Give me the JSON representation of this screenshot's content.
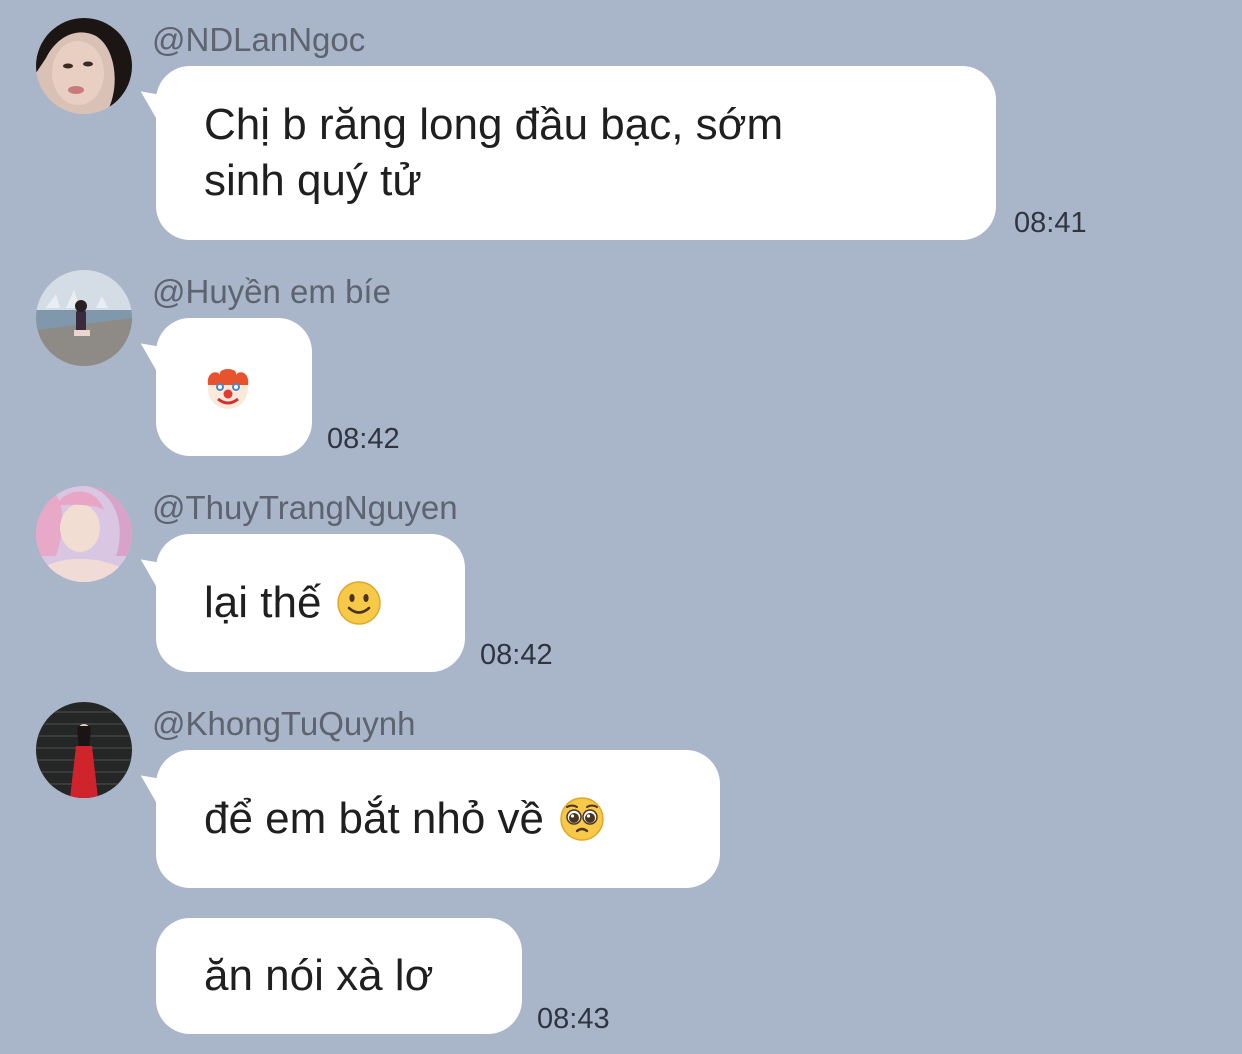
{
  "messages": [
    {
      "username": "@NDLanNgoc",
      "text_lines": [
        "Chị b răng long đầu bạc, sớm",
        "sinh quý tử"
      ],
      "time": "08:41",
      "avatar_icon": "avatar-woman-closeup"
    },
    {
      "username": "@Huyền em bíe",
      "emoji": "clown-face-emoji",
      "time": "08:42",
      "avatar_icon": "avatar-woman-harbor"
    },
    {
      "username": "@ThuyTrangNguyen",
      "text": "lại thế",
      "emoji": "slightly-smiling-face-emoji",
      "time": "08:42",
      "avatar_icon": "avatar-woman-pink-hair"
    },
    {
      "username": "@KhongTuQuynh",
      "text": "để em bắt nhỏ về",
      "emoji": "pleading-face-emoji",
      "time": null,
      "avatar_icon": "avatar-woman-red-dress"
    },
    {
      "text": "ăn nói xà lơ",
      "time": "08:43"
    }
  ],
  "colors": {
    "background": "#a9b5c9",
    "bubble": "#ffffff",
    "username": "#5d6470",
    "time": "#2f3540"
  }
}
